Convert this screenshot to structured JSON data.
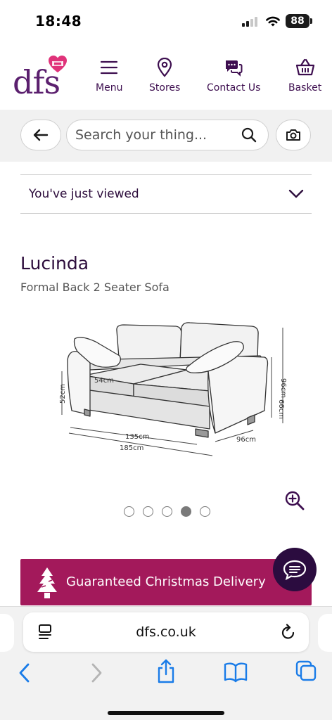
{
  "status_bar": {
    "time": "18:48",
    "battery": "88"
  },
  "header": {
    "logo_text": "dfs",
    "nav": [
      {
        "label": "Menu",
        "icon": "menu-icon"
      },
      {
        "label": "Stores",
        "icon": "location-pin-icon"
      },
      {
        "label": "Contact Us",
        "icon": "chat-bubbles-icon"
      },
      {
        "label": "Basket",
        "icon": "basket-icon"
      }
    ]
  },
  "search": {
    "placeholder": "Search your thing..."
  },
  "just_viewed": {
    "label": "You've just viewed"
  },
  "product": {
    "name": "Lucinda",
    "subtitle": "Formal Back 2 Seater Sofa",
    "dimensions": {
      "seat_depth": "54cm",
      "seat_height": "52cm",
      "arm_height": "66cm",
      "total_height": "96cm",
      "seat_width": "135cm",
      "total_width": "185cm",
      "depth": "96cm"
    },
    "carousel": {
      "total": 5,
      "active_index": 3
    }
  },
  "banner": {
    "text": "Guaranteed Christmas Delivery"
  },
  "safari": {
    "url": "dfs.co.uk"
  },
  "colors": {
    "brand_purple": "#5b1f6e",
    "banner_magenta": "#a3195b",
    "chat_dark": "#2b0c3f",
    "ios_blue": "#1a7ce8"
  }
}
